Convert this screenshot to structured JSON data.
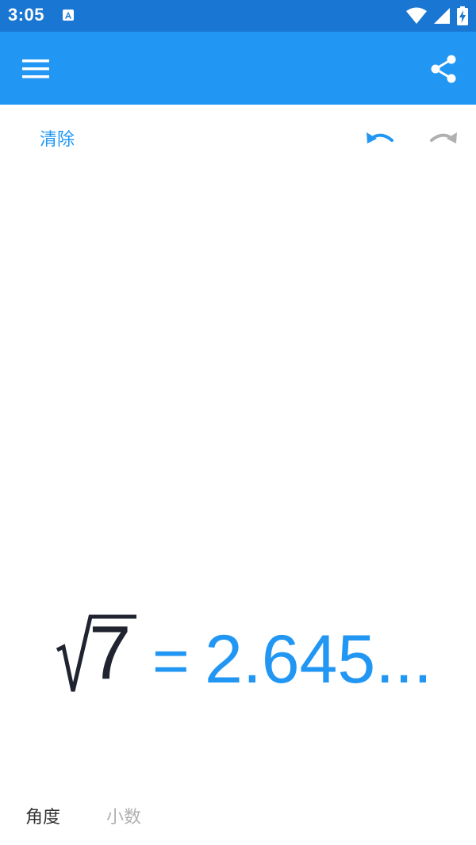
{
  "status_bar": {
    "time": "3:05",
    "icons": [
      "notification-a-icon",
      "wifi-icon",
      "cell-signal-icon",
      "battery-charging-icon"
    ]
  },
  "app_bar": {
    "menu_icon": "menu-icon",
    "share_icon": "share-icon",
    "background": "#2196f3"
  },
  "toolbar": {
    "clear_label": "清除",
    "undo_icon": "undo-icon",
    "redo_icon": "redo-icon"
  },
  "expression": {
    "radical": "√",
    "radicand": "7",
    "equals": "=",
    "result": "2.645..."
  },
  "bottom_bar": {
    "angle_label": "角度",
    "decimal_label": "小数"
  },
  "colors": {
    "accent": "#2196f3",
    "status_bar": "#1976d2",
    "dark_text": "#1f2430",
    "disabled": "#b0b0b0"
  }
}
